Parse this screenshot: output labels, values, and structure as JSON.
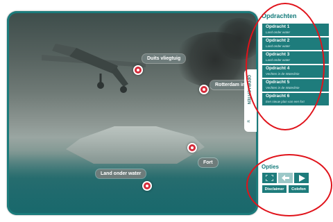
{
  "stage": {
    "hotspots": [
      {
        "label": "Duits vliegtuig"
      },
      {
        "label": "Rotterdam in"
      },
      {
        "label": "Fort"
      },
      {
        "label": "Land onder water"
      }
    ]
  },
  "collapse_tab": {
    "label": "OPDRACHTEN",
    "arrow": "«"
  },
  "sidebar": {
    "title": "Opdrachten",
    "tasks": [
      {
        "title": "Opdracht 1",
        "subtitle": "Land onder water"
      },
      {
        "title": "Opdracht 2",
        "subtitle": "Land onder water"
      },
      {
        "title": "Opdracht 3",
        "subtitle": "Land onder water"
      },
      {
        "title": "Opdracht 4",
        "subtitle": "Vechten in de Waterlinie"
      },
      {
        "title": "Opdracht 5",
        "subtitle": "Vechten in de Waterlinie"
      },
      {
        "title": "Opdracht 6",
        "subtitle": "Een nieuw plan van een fort"
      }
    ],
    "options_title": "Opties",
    "controls": {
      "fullscreen_icon": "fullscreen-icon",
      "back_icon": "back-arrow-icon",
      "play_icon": "play-icon"
    },
    "disclaimer_label": "Disclaimer",
    "colofon_label": "Colofon"
  },
  "colors": {
    "accent": "#1e7c7c",
    "annotation": "#e0131b",
    "hotspot": "#d52b3a"
  }
}
